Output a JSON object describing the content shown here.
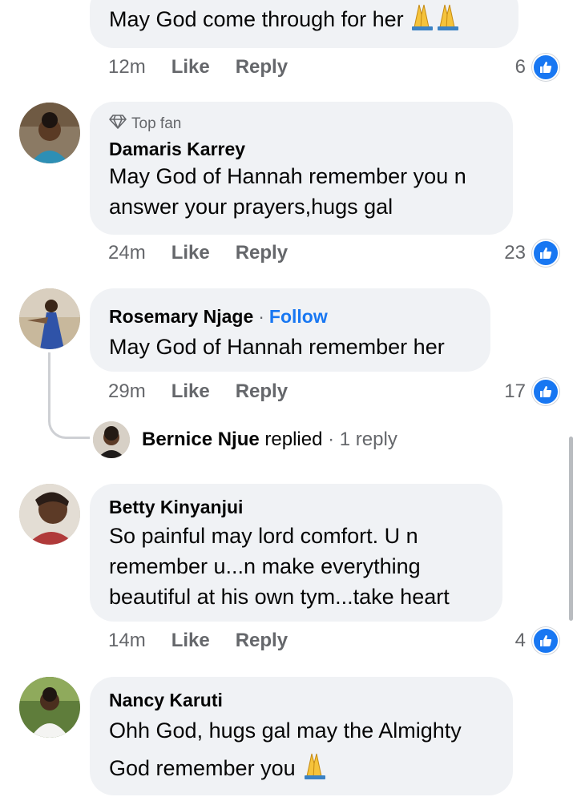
{
  "comments": [
    {
      "text": "May God come through for her",
      "emoji": "🙏🙏",
      "time": "12m",
      "like_label": "Like",
      "reply_label": "Reply",
      "reaction_count": "6"
    },
    {
      "badge": "Top fan",
      "author": "Damaris Karrey",
      "text_lines": [
        "May God of Hannah remember you n",
        "answer your prayers,hugs gal"
      ],
      "time": "24m",
      "like_label": "Like",
      "reply_label": "Reply",
      "reaction_count": "23"
    },
    {
      "author": "Rosemary Njage",
      "follow_label": "Follow",
      "text": "May God of Hannah remember her",
      "time": "29m",
      "like_label": "Like",
      "reply_label": "Reply",
      "reaction_count": "17",
      "reply_summary": {
        "author": "Bernice Njue",
        "verb": "replied",
        "count": "1 reply"
      }
    },
    {
      "author": "Betty Kinyanjui",
      "text_lines": [
        "So painful may lord comfort. U n",
        "remember u...n make everything",
        "beautiful at his own tym...take heart"
      ],
      "time": "14m",
      "like_label": "Like",
      "reply_label": "Reply",
      "reaction_count": "4"
    },
    {
      "author": "Nancy Karuti",
      "text_lines": [
        "Ohh God, hugs gal may the Almighty",
        "God remember you"
      ],
      "emoji": "🙏"
    }
  ],
  "colors": {
    "accent": "#1877f2",
    "bubble": "#f0f2f5",
    "muted": "#65676b"
  },
  "icons": [
    "top-fan-diamond-icon",
    "like-reaction-icon",
    "praying-hands-emoji"
  ]
}
